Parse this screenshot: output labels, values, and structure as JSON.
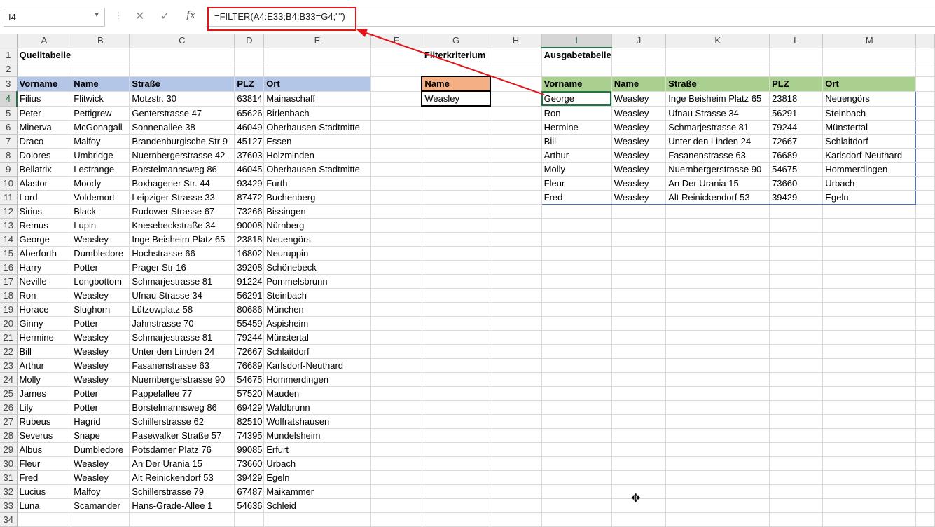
{
  "formula_bar": {
    "name_box": "I4",
    "formula": "=FILTER(A4:E33;B4:B33=G4;\"\")",
    "cancel_icon": "✕",
    "enter_icon": "✓",
    "fx_label": "fx",
    "dots": "⋮"
  },
  "columns": [
    "A",
    "B",
    "C",
    "D",
    "E",
    "F",
    "G",
    "H",
    "I",
    "J",
    "K",
    "L",
    "M"
  ],
  "selected_column": "I",
  "selected_row": 4,
  "titles": {
    "source": "Quelltabelle",
    "criterion": "Filterkriterium",
    "output": "Ausgabetabelle"
  },
  "source_table": {
    "headers": [
      "Vorname",
      "Name",
      "Straße",
      "PLZ",
      "Ort"
    ],
    "rows": [
      [
        "Filius",
        "Flitwick",
        "Motzstr. 30",
        "63814",
        "Mainaschaff"
      ],
      [
        "Peter",
        "Pettigrew",
        "Genterstrasse 47",
        "65626",
        "Birlenbach"
      ],
      [
        "Minerva",
        "McGonagall",
        "Sonnenallee 38",
        "46049",
        "Oberhausen Stadtmitte"
      ],
      [
        "Draco",
        "Malfoy",
        "Brandenburgische Str 9",
        "45127",
        "Essen"
      ],
      [
        "Dolores",
        "Umbridge",
        "Nuernbergerstrasse 42",
        "37603",
        "Holzminden"
      ],
      [
        "Bellatrix",
        "Lestrange",
        "Borstelmannsweg 86",
        "46045",
        "Oberhausen Stadtmitte"
      ],
      [
        "Alastor",
        "Moody",
        "Boxhagener Str. 44",
        "93429",
        "Furth"
      ],
      [
        "Lord",
        "Voldemort",
        "Leipziger Strasse 33",
        "87472",
        "Buchenberg"
      ],
      [
        "Sirius",
        "Black",
        "Rudower Strasse 67",
        "73266",
        "Bissingen"
      ],
      [
        "Remus",
        "Lupin",
        "Knesebeckstraße 34",
        "90008",
        "Nürnberg"
      ],
      [
        "George",
        "Weasley",
        "Inge Beisheim Platz 65",
        "23818",
        "Neuengörs"
      ],
      [
        "Aberforth",
        "Dumbledore",
        "Hochstrasse 66",
        "16802",
        "Neuruppin"
      ],
      [
        "Harry",
        "Potter",
        "Prager Str 16",
        "39208",
        "Schönebeck"
      ],
      [
        "Neville",
        "Longbottom",
        "Schmarjestrasse 81",
        "91224",
        "Pommelsbrunn"
      ],
      [
        "Ron",
        "Weasley",
        "Ufnau Strasse 34",
        "56291",
        "Steinbach"
      ],
      [
        "Horace",
        "Slughorn",
        "Lützowplatz 58",
        "80686",
        "München"
      ],
      [
        "Ginny",
        "Potter",
        "Jahnstrasse 70",
        "55459",
        "Aspisheim"
      ],
      [
        "Hermine",
        "Weasley",
        "Schmarjestrasse 81",
        "79244",
        "Münstertal"
      ],
      [
        "Bill",
        "Weasley",
        "Unter den Linden 24",
        "72667",
        "Schlaitdorf"
      ],
      [
        "Arthur",
        "Weasley",
        "Fasanenstrasse 63",
        "76689",
        "Karlsdorf-Neuthard"
      ],
      [
        "Molly",
        "Weasley",
        "Nuernbergerstrasse 90",
        "54675",
        "Hommerdingen"
      ],
      [
        "James",
        "Potter",
        "Pappelallee 77",
        "57520",
        "Mauden"
      ],
      [
        "Lily",
        "Potter",
        "Borstelmannsweg 86",
        "69429",
        "Waldbrunn"
      ],
      [
        "Rubeus",
        "Hagrid",
        "Schillerstrasse 62",
        "82510",
        "Wolfratshausen"
      ],
      [
        "Severus",
        "Snape",
        "Pasewalker Straße 57",
        "74395",
        "Mundelsheim"
      ],
      [
        "Albus",
        "Dumbledore",
        "Potsdamer Platz 76",
        "99085",
        "Erfurt"
      ],
      [
        "Fleur",
        "Weasley",
        "An Der Urania 15",
        "73660",
        "Urbach"
      ],
      [
        "Fred",
        "Weasley",
        "Alt Reinickendorf 53",
        "39429",
        "Egeln"
      ],
      [
        "Lucius",
        "Malfoy",
        "Schillerstrasse 79",
        "67487",
        "Maikammer"
      ],
      [
        "Luna",
        "Scamander",
        "Hans-Grade-Allee 1",
        "54636",
        "Schleid"
      ]
    ]
  },
  "criterion": {
    "header": "Name",
    "value": "Weasley"
  },
  "output_table": {
    "headers": [
      "Vorname",
      "Name",
      "Straße",
      "PLZ",
      "Ort"
    ],
    "rows": [
      [
        "George",
        "Weasley",
        "Inge Beisheim Platz 65",
        "23818",
        "Neuengörs"
      ],
      [
        "Ron",
        "Weasley",
        "Ufnau Strasse 34",
        "56291",
        "Steinbach"
      ],
      [
        "Hermine",
        "Weasley",
        "Schmarjestrasse 81",
        "79244",
        "Münstertal"
      ],
      [
        "Bill",
        "Weasley",
        "Unter den Linden 24",
        "72667",
        "Schlaitdorf"
      ],
      [
        "Arthur",
        "Weasley",
        "Fasanenstrasse 63",
        "76689",
        "Karlsdorf-Neuthard"
      ],
      [
        "Molly",
        "Weasley",
        "Nuernbergerstrasse 90",
        "54675",
        "Hommerdingen"
      ],
      [
        "Fleur",
        "Weasley",
        "An Der Urania 15",
        "73660",
        "Urbach"
      ],
      [
        "Fred",
        "Weasley",
        "Alt Reinickendorf 53",
        "39429",
        "Egeln"
      ]
    ]
  },
  "colors": {
    "source_header": "#b4c6e7",
    "criterion_header": "#f4b084",
    "output_header": "#a9d08e",
    "annotation": "#e3151a",
    "selection": "#217346"
  }
}
